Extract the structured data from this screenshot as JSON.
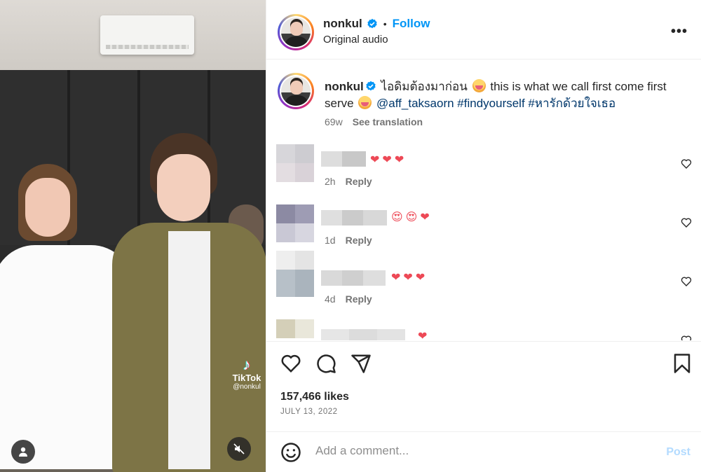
{
  "media": {
    "watermark_brand": "TikTok",
    "watermark_handle": "@nonkul",
    "icons": [
      "user-tag-icon",
      "mute-icon"
    ]
  },
  "header": {
    "username": "nonkul",
    "verified": true,
    "follow_label": "Follow",
    "audio_label": "Original audio",
    "more_label": "•••"
  },
  "caption": {
    "username": "nonkul",
    "thai_text": "ไอดิมต้องมาก่อน",
    "english_text": "this is what we call first come first serve",
    "mention": "@aff_taksaorn",
    "hashtag_1": "#findyourself",
    "hashtag_2": "#หารักด้วยใจเธอ",
    "age": "69w",
    "see_translation": "See translation"
  },
  "comments": [
    {
      "hearts": "❤❤❤",
      "age": "2h",
      "reply": "Reply"
    },
    {
      "hearts": "😍😍❤",
      "age": "1d",
      "reply": "Reply"
    },
    {
      "hearts": "❤❤❤",
      "age": "4d",
      "reply": "Reply"
    },
    {
      "hearts": "❤",
      "age": "",
      "reply": ""
    }
  ],
  "actions": {
    "icons": [
      "heart-icon",
      "comment-icon",
      "share-icon",
      "bookmark-icon"
    ]
  },
  "stats": {
    "likes": "157,466 likes",
    "date": "JULY 13, 2022"
  },
  "add_comment": {
    "placeholder": "Add a comment...",
    "post_label": "Post"
  },
  "colors": {
    "accent_blue": "#0095f6",
    "link_blue": "#00376b",
    "heart_red": "#ed4956",
    "muted_gray": "#737373",
    "post_disabled": "#b3dbff"
  }
}
